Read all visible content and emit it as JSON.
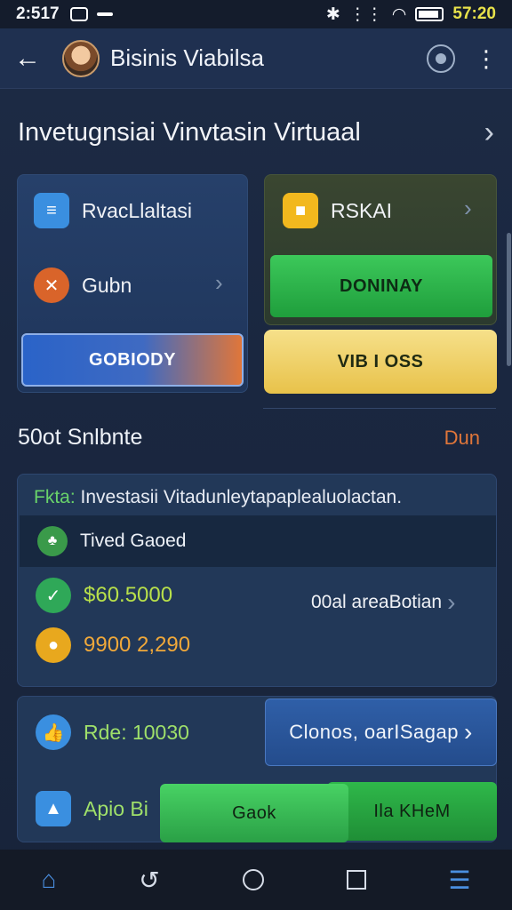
{
  "status": {
    "time_left": "2:517",
    "time_right": "57:20"
  },
  "appbar": {
    "title": "Bisinis Viabilsa"
  },
  "section": {
    "title": "Invetugnsiai Vinvtasin Virtuaal"
  },
  "left_card": {
    "item1": "RvacLlaltasi",
    "item2": "Gubn",
    "button": "GOBIODY"
  },
  "right_card": {
    "item1": "RSKAI",
    "button_green": "DONINAY",
    "button_yellow": "VIB I OSS"
  },
  "section2": {
    "title": "50ot Snlbnte",
    "link": "Dun"
  },
  "panel": {
    "head_label": "Fkta:",
    "head_text": "Investasii Vitadunleytapaplealuolactan.",
    "sub": "Tived Gaoed",
    "amount1": "$60.5000",
    "amount1_note": "00al areaBotian",
    "amount2": "9900 2,290"
  },
  "panel2": {
    "row1_label": "Rde: 10030",
    "row1_button": "Clonos, oarISagap",
    "row2_label": "Apio Bi",
    "row2_button_left": "Gaok",
    "row2_button_right": "Ila KHeM"
  },
  "colors": {
    "accent_green": "#2fb84a",
    "accent_orange": "#e0763a",
    "amount_green": "#b8e04a",
    "amount_orange": "#f0a83a"
  },
  "icons": {
    "status": [
      "whatsapp-icon",
      "notification-icon",
      "bluetooth-icon",
      "vibrate-icon",
      "wifi-icon",
      "battery-icon"
    ],
    "appbar": [
      "back-arrow-icon",
      "account-icon",
      "more-vert-icon"
    ],
    "nav": [
      "home-icon",
      "back-icon",
      "home-circle-icon",
      "recents-icon",
      "menu-icon"
    ]
  }
}
